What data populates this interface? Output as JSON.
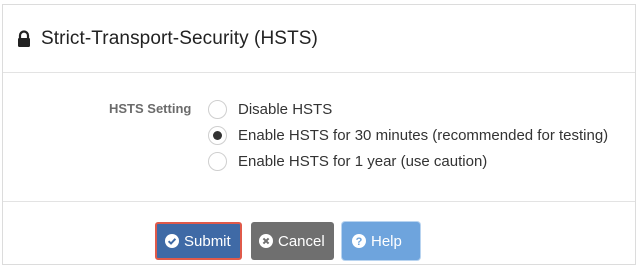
{
  "panel": {
    "title": "Strict-Transport-Security (HSTS)"
  },
  "form": {
    "field_label": "HSTS Setting",
    "options": [
      {
        "label": "Disable HSTS",
        "selected": false
      },
      {
        "label": "Enable HSTS for 30 minutes (recommended for testing)",
        "selected": true
      },
      {
        "label": "Enable HSTS for 1 year (use caution)",
        "selected": false
      }
    ]
  },
  "buttons": {
    "submit": "Submit",
    "cancel": "Cancel",
    "help": "Help"
  },
  "icons": {
    "header": "lock-icon",
    "submit": "check-circle-icon",
    "cancel": "times-circle-icon",
    "help": "question-circle-icon"
  },
  "colors": {
    "submit_bg": "#3f6aa6",
    "submit_highlight": "#e05a4a",
    "cancel_bg": "#6f6f6f",
    "help_bg": "#6ea4dd"
  }
}
